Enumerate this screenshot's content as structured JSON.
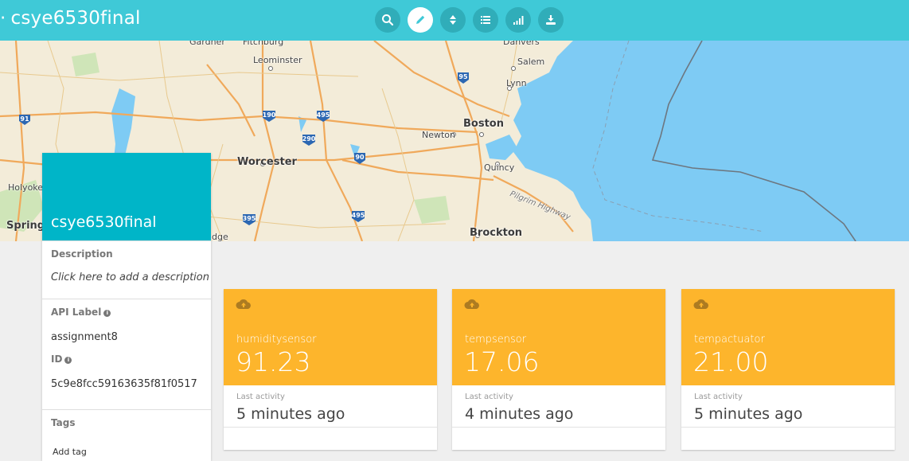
{
  "header": {
    "title": "csye6530final",
    "toolbar": [
      {
        "icon": "search-icon"
      },
      {
        "icon": "pencil-icon"
      },
      {
        "icon": "sort-icon"
      },
      {
        "icon": "list-icon"
      },
      {
        "icon": "signal-bars-icon"
      },
      {
        "icon": "download-icon"
      }
    ]
  },
  "map": {
    "places": {
      "gardner": "Gardner",
      "fitchburg": "Fitchburg",
      "danvers": "Danvers",
      "leominster": "Leominster",
      "salem": "Salem",
      "lynn": "Lynn",
      "boston": "Boston",
      "newton": "Newton",
      "worcester": "Worcester",
      "quincy": "Quincy",
      "holyoke": "Holyoke",
      "springfield": "Spring",
      "brockton": "Brockton",
      "bridge": "dge",
      "pilgrim": "Pilgrim Highway"
    },
    "shields": [
      "91",
      "190",
      "495",
      "290",
      "90",
      "95",
      "395",
      "495"
    ]
  },
  "device": {
    "name": "csye6530final",
    "description_label": "Description",
    "description_placeholder": "Click here to add a description",
    "api_label_label": "API Label",
    "api_label_value": "assignment8",
    "id_label": "ID",
    "id_value": "5c9e8fcc59163635f81f0517",
    "tags_label": "Tags",
    "add_tag": "Add tag"
  },
  "variables": [
    {
      "name": "humiditysensor",
      "value": "91.23",
      "last_activity_label": "Last activity",
      "last_activity": "5 minutes ago"
    },
    {
      "name": "tempsensor",
      "value": "17.06",
      "last_activity_label": "Last activity",
      "last_activity": "4 minutes ago"
    },
    {
      "name": "tempactuator",
      "value": "21.00",
      "last_activity_label": "Last activity",
      "last_activity": "5 minutes ago"
    }
  ],
  "colors": {
    "topbar": "#3fc9d7",
    "device_header": "#00b5c8",
    "variable_card": "#fdb52c",
    "water": "#7ecbf4"
  }
}
